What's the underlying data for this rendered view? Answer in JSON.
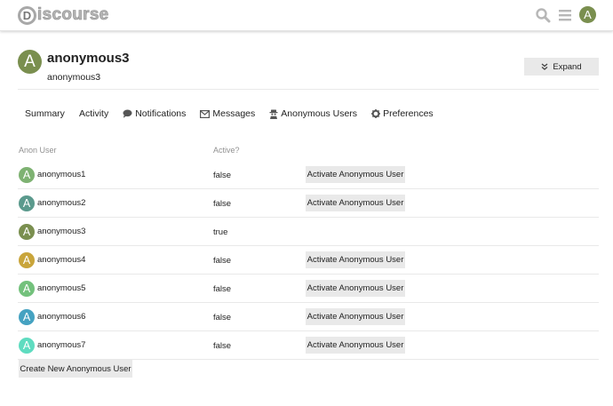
{
  "header": {
    "logo_text": "iscourse",
    "logo_letter": "D",
    "avatar_letter": "A",
    "search_icon": "search-icon",
    "menu_icon": "hamburger-menu-icon",
    "avatar_color": "#7a8f4f"
  },
  "profile": {
    "avatar_letter": "A",
    "avatar_color": "#7a8f4f",
    "username": "anonymous3",
    "subname": "anonymous3",
    "expand_label": "Expand"
  },
  "nav": {
    "summary": "Summary",
    "activity": "Activity",
    "notifications": "Notifications",
    "messages": "Messages",
    "anonymous_users": "Anonymous Users",
    "preferences": "Preferences"
  },
  "table": {
    "col_user": "Anon User",
    "col_active": "Active?",
    "action_label": "Activate Anonymous User",
    "rows": [
      {
        "letter": "A",
        "name": "anonymous1",
        "active": "false",
        "color": "#7eb272",
        "show_button": true
      },
      {
        "letter": "A",
        "name": "anonymous2",
        "active": "false",
        "color": "#5b9a8d",
        "show_button": true
      },
      {
        "letter": "A",
        "name": "anonymous3",
        "active": "true",
        "color": "#7a8f4f",
        "show_button": false
      },
      {
        "letter": "A",
        "name": "anonymous4",
        "active": "false",
        "color": "#c9a53b",
        "show_button": true
      },
      {
        "letter": "A",
        "name": "anonymous5",
        "active": "false",
        "color": "#73c17c",
        "show_button": true
      },
      {
        "letter": "A",
        "name": "anonymous6",
        "active": "false",
        "color": "#45a2c1",
        "show_button": true
      },
      {
        "letter": "A",
        "name": "anonymous7",
        "active": "false",
        "color": "#5fdcc0",
        "show_button": true
      }
    ]
  },
  "create_label": "Create New Anonymous User"
}
